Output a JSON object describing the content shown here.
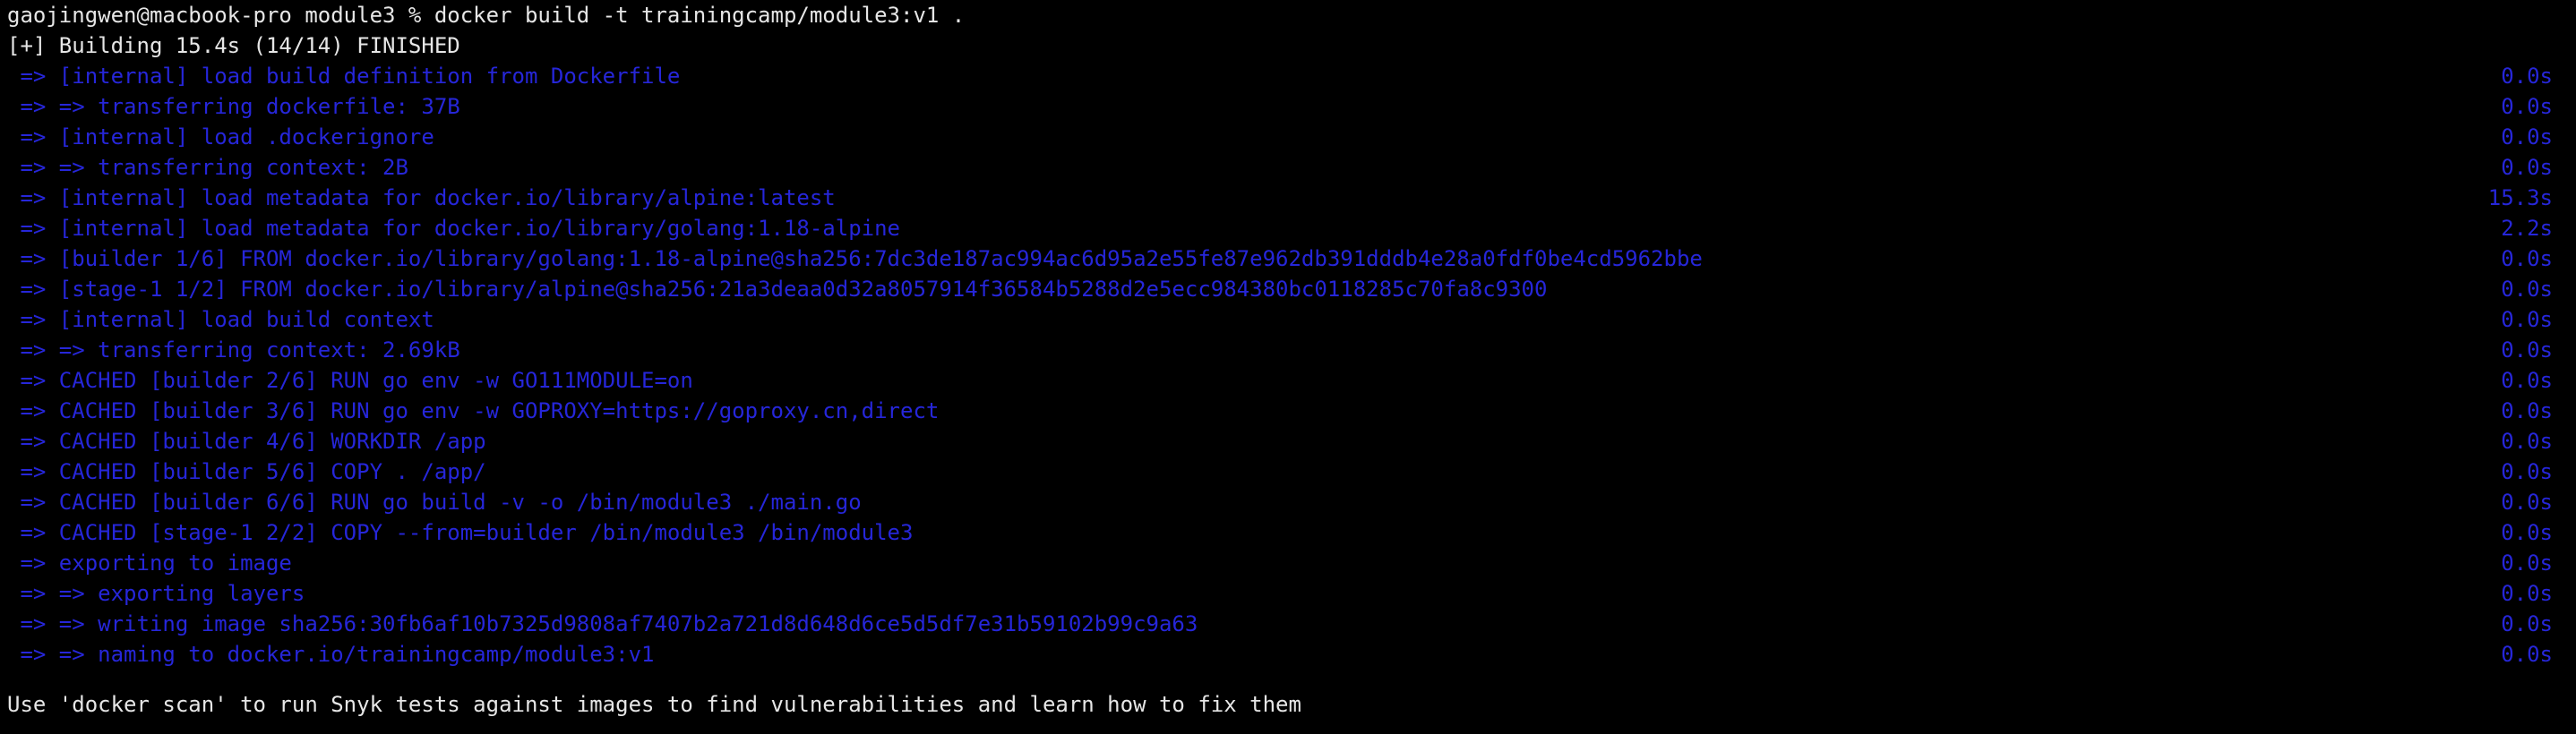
{
  "terminal": {
    "prompt": "gaojingwen@macbook-pro module3 % docker build -t trainingcamp/module3:v1 .",
    "status": "[+] Building 15.4s (14/14) FINISHED",
    "steps": [
      {
        "text": " => [internal] load build definition from Dockerfile",
        "time": "0.0s"
      },
      {
        "text": " => => transferring dockerfile: 37B",
        "time": "0.0s"
      },
      {
        "text": " => [internal] load .dockerignore",
        "time": "0.0s"
      },
      {
        "text": " => => transferring context: 2B",
        "time": "0.0s"
      },
      {
        "text": " => [internal] load metadata for docker.io/library/alpine:latest",
        "time": "15.3s"
      },
      {
        "text": " => [internal] load metadata for docker.io/library/golang:1.18-alpine",
        "time": "2.2s"
      },
      {
        "text": " => [builder 1/6] FROM docker.io/library/golang:1.18-alpine@sha256:7dc3de187ac994ac6d95a2e55fe87e962db391dddb4e28a0fdf0be4cd5962bbe",
        "time": "0.0s"
      },
      {
        "text": " => [stage-1 1/2] FROM docker.io/library/alpine@sha256:21a3deaa0d32a8057914f36584b5288d2e5ecc984380bc0118285c70fa8c9300",
        "time": "0.0s"
      },
      {
        "text": " => [internal] load build context",
        "time": "0.0s"
      },
      {
        "text": " => => transferring context: 2.69kB",
        "time": "0.0s"
      },
      {
        "text": " => CACHED [builder 2/6] RUN go env -w GO111MODULE=on",
        "time": "0.0s"
      },
      {
        "text": " => CACHED [builder 3/6] RUN go env -w GOPROXY=https://goproxy.cn,direct",
        "time": "0.0s"
      },
      {
        "text": " => CACHED [builder 4/6] WORKDIR /app",
        "time": "0.0s"
      },
      {
        "text": " => CACHED [builder 5/6] COPY . /app/",
        "time": "0.0s"
      },
      {
        "text": " => CACHED [builder 6/6] RUN go build -v -o /bin/module3 ./main.go",
        "time": "0.0s"
      },
      {
        "text": " => CACHED [stage-1 2/2] COPY --from=builder /bin/module3 /bin/module3",
        "time": "0.0s"
      },
      {
        "text": " => exporting to image",
        "time": "0.0s"
      },
      {
        "text": " => => exporting layers",
        "time": "0.0s"
      },
      {
        "text": " => => writing image sha256:30fb6af10b7325d9808af7407b2a721d8d648d6ce5d5df7e31b59102b99c9a63",
        "time": "0.0s"
      },
      {
        "text": " => => naming to docker.io/trainingcamp/module3:v1",
        "time": "0.0s"
      }
    ],
    "hint": "Use 'docker scan' to run Snyk tests against images to find vulnerabilities and learn how to fix them"
  },
  "colors": {
    "background": "#000000",
    "default_text": "#e6e6e6",
    "build_step_text": "#2626d9"
  }
}
